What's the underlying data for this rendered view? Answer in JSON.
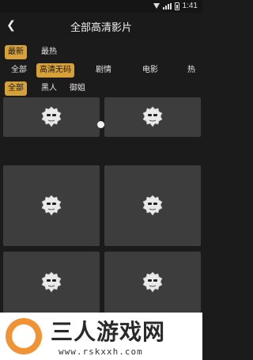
{
  "status": {
    "time": "1:41"
  },
  "title_bar": {
    "title": "全部高清影片",
    "back_icon": "arrow-left-icon"
  },
  "filters": {
    "sort": [
      "最新",
      "最热"
    ],
    "category": [
      "全部",
      "高清无码",
      "剧情",
      "电影",
      "热"
    ],
    "tag": [
      "全部",
      "黑人",
      "御姐"
    ],
    "active_color": "#d7a13a"
  },
  "videos": [
    {
      "thumbnail_icon": "placeholder-face-icon"
    },
    {
      "thumbnail_icon": "placeholder-face-icon"
    },
    {
      "thumbnail_icon": "placeholder-face-icon"
    },
    {
      "thumbnail_icon": "placeholder-face-icon"
    },
    {
      "thumbnail_icon": "placeholder-face-icon"
    },
    {
      "thumbnail_icon": "placeholder-face-icon"
    }
  ],
  "watermark": {
    "title": "三人游戏网",
    "url": "www.rskxxh.com",
    "color": "#f19234"
  }
}
